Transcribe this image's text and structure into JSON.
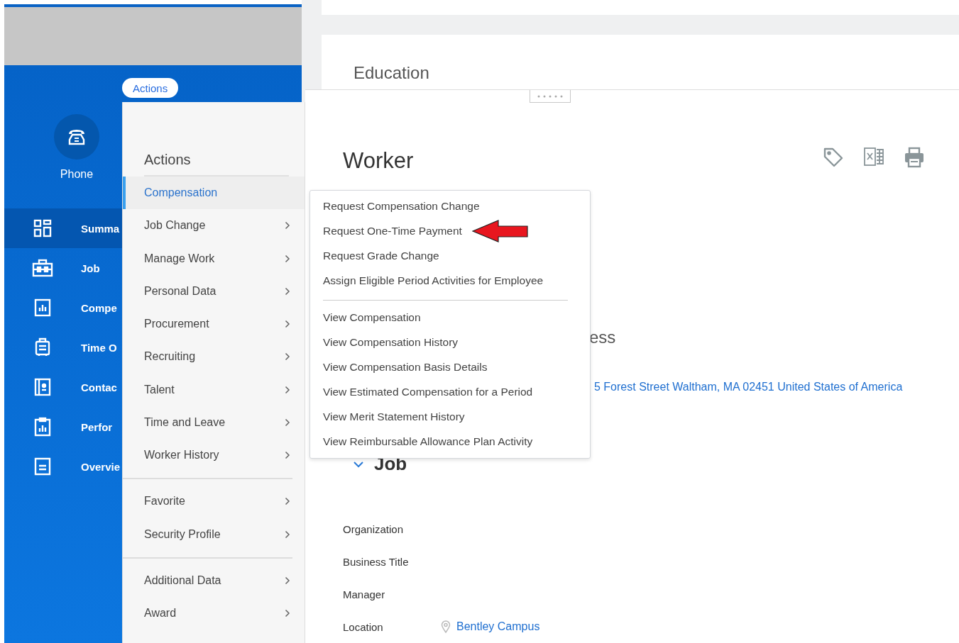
{
  "actions_button": "Actions",
  "sidebar": {
    "quick_action": {
      "label": "Phone"
    },
    "items": [
      {
        "label": "Summa",
        "selected": true
      },
      {
        "label": "Job",
        "selected": false
      },
      {
        "label": "Compe",
        "selected": false
      },
      {
        "label": "Time O",
        "selected": false
      },
      {
        "label": "Contac",
        "selected": false
      },
      {
        "label": "Perfor",
        "selected": false
      },
      {
        "label": "Overvie",
        "selected": false
      }
    ]
  },
  "actions_menu": {
    "title": "Actions",
    "groups": [
      [
        {
          "label": "Compensation",
          "selected": true
        },
        {
          "label": "Job Change",
          "selected": false
        },
        {
          "label": "Manage Work",
          "selected": false
        },
        {
          "label": "Personal Data",
          "selected": false
        },
        {
          "label": "Procurement",
          "selected": false
        },
        {
          "label": "Recruiting",
          "selected": false
        },
        {
          "label": "Talent",
          "selected": false
        },
        {
          "label": "Time and Leave",
          "selected": false
        },
        {
          "label": "Worker History",
          "selected": false
        }
      ],
      [
        {
          "label": "Favorite",
          "selected": false
        },
        {
          "label": "Security Profile",
          "selected": false
        }
      ],
      [
        {
          "label": "Additional Data",
          "selected": false
        },
        {
          "label": "Award",
          "selected": false
        }
      ]
    ]
  },
  "submenu": {
    "groups": [
      [
        {
          "label": "Request Compensation Change",
          "annotated": false
        },
        {
          "label": "Request One-Time Payment",
          "annotated": true
        },
        {
          "label": "Request Grade Change",
          "annotated": false
        },
        {
          "label": "Assign Eligible Period Activities for Employee",
          "annotated": false
        }
      ],
      [
        {
          "label": "View Compensation",
          "annotated": false
        },
        {
          "label": "View Compensation History",
          "annotated": false
        },
        {
          "label": "View Compensation Basis Details",
          "annotated": false
        },
        {
          "label": "View Estimated Compensation for a Period",
          "annotated": false
        },
        {
          "label": "View Merit Statement History",
          "annotated": false
        },
        {
          "label": "View Reimbursable Allowance Plan Activity",
          "annotated": false
        }
      ]
    ]
  },
  "page": {
    "section_title": "Education",
    "card_title": "Worker",
    "partial_heading": "ess",
    "address_link": "5 Forest Street Waltham, MA 02451 United States of America",
    "job": {
      "title": "Job",
      "expanded": true,
      "fields": [
        {
          "label": "Organization"
        },
        {
          "label": "Business Title"
        },
        {
          "label": "Manager"
        },
        {
          "label": "Location",
          "value": "Bentley Campus"
        }
      ]
    }
  }
}
